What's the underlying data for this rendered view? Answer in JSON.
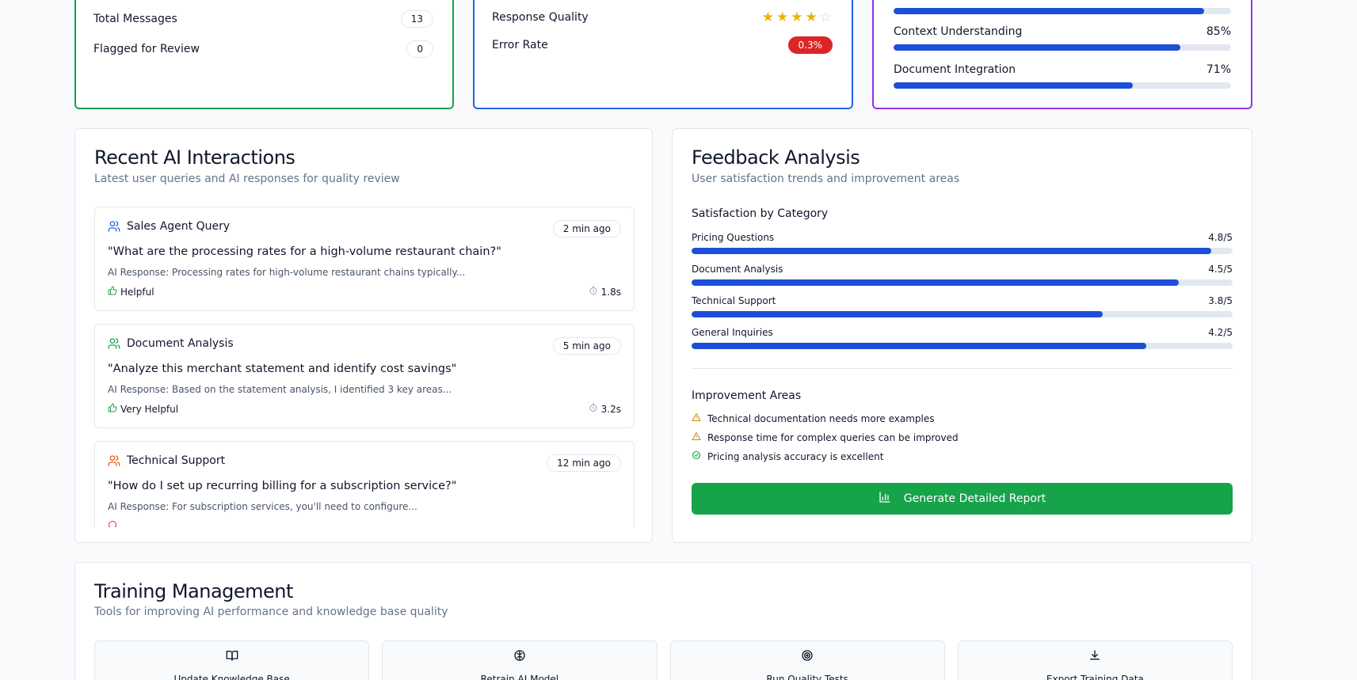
{
  "colors": {
    "accent_blue": "#1d4ed8",
    "green": "#16a34a",
    "blue": "#2563eb",
    "purple": "#9333ea",
    "red": "#dc2626",
    "star": "#eab308"
  },
  "activity_card": {
    "rows": [
      {
        "label": "Total Messages",
        "value": "13"
      },
      {
        "label": "Flagged for Review",
        "value": "0"
      }
    ]
  },
  "quality_card": {
    "response_quality_label": "Response Quality",
    "response_quality_stars": 4,
    "error_rate_label": "Error Rate",
    "error_rate_value": "0.3%"
  },
  "performance_card": {
    "rows": [
      {
        "label": "Context Understanding",
        "value": "85%",
        "level": 85
      },
      {
        "label": "Document Integration",
        "value": "71%",
        "level": 71
      }
    ],
    "partial_bar_level": 92
  },
  "interactions": {
    "title": "Recent AI Interactions",
    "subtitle": "Latest user queries and AI responses for quality review",
    "items": [
      {
        "title": "Sales Agent Query",
        "time": "2 min ago",
        "query": "\"What are the processing rates for a high-volume restaurant chain?\"",
        "response": "AI Response: Processing rates for high-volume restaurant chains typically...",
        "rating": "Helpful",
        "duration": "1.8s",
        "icon_color": "#2563eb"
      },
      {
        "title": "Document Analysis",
        "time": "5 min ago",
        "query": "\"Analyze this merchant statement and identify cost savings\"",
        "response": "AI Response: Based on the statement analysis, I identified 3 key areas...",
        "rating": "Very Helpful",
        "duration": "3.2s",
        "icon_color": "#16a34a"
      },
      {
        "title": "Technical Support",
        "time": "12 min ago",
        "query": "\"How do I set up recurring billing for a subscription service?\"",
        "response": "AI Response: For subscription services, you'll need to configure...",
        "rating": "",
        "duration": "",
        "icon_color": "#ea580c"
      }
    ]
  },
  "feedback": {
    "title": "Feedback Analysis",
    "subtitle": "User satisfaction trends and improvement areas",
    "satisfaction_title": "Satisfaction by Category",
    "categories": [
      {
        "label": "Pricing Questions",
        "value": "4.8/5",
        "score": 4.8
      },
      {
        "label": "Document Analysis",
        "value": "4.5/5",
        "score": 4.5
      },
      {
        "label": "Technical Support",
        "value": "3.8/5",
        "score": 3.8
      },
      {
        "label": "General Inquiries",
        "value": "4.2/5",
        "score": 4.2
      }
    ],
    "improvement_title": "Improvement Areas",
    "improvements": [
      {
        "text": "Technical documentation needs more examples",
        "icon": "warning-icon"
      },
      {
        "text": "Response time for complex queries can be improved",
        "icon": "warning-icon"
      },
      {
        "text": "Pricing analysis accuracy is excellent",
        "icon": "check-circle-icon"
      }
    ],
    "report_button": "Generate Detailed Report"
  },
  "training": {
    "title": "Training Management",
    "subtitle": "Tools for improving AI performance and knowledge base quality",
    "tools": [
      {
        "label": "Update Knowledge Base",
        "icon": "book-icon"
      },
      {
        "label": "Retrain AI Model",
        "icon": "brain-icon"
      },
      {
        "label": "Run Quality Tests",
        "icon": "target-icon"
      },
      {
        "label": "Export Training Data",
        "icon": "download-icon"
      }
    ]
  }
}
